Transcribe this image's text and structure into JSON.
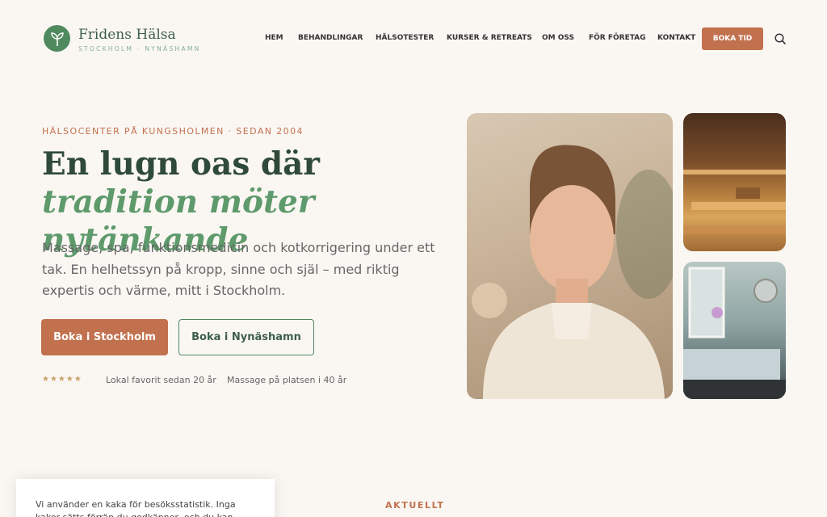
{
  "brand": {
    "name": "Fridens Hälsa",
    "subtitle": "STOCKHOLM · NYNÄSHAMN",
    "logo_icon": "sprout-icon"
  },
  "nav": {
    "items": [
      {
        "label": "HEM"
      },
      {
        "label": "BEHANDLINGAR"
      },
      {
        "label": "HÄLSOTESTER"
      },
      {
        "label": "KURSER & RETREATS"
      },
      {
        "label": "OM OSS"
      },
      {
        "label": "FÖR FÖRETAG"
      },
      {
        "label": "KONTAKT"
      }
    ],
    "book_label": "BOKA TID",
    "search_icon": "search-icon"
  },
  "hero": {
    "eyebrow": "HÄLSOCENTER PÅ KUNGSHOLMEN · SEDAN 2004",
    "title_plain": "En lugn oas där ",
    "title_highlight": "tradition möter nytänkande",
    "text": "Massage, spa, funktionsmedicin och kotkorrigering under ett tak. En helhetssyn på kropp, sinne och själ – med riktig expertis och värme, mitt i Stockholm.",
    "btn_primary": "Boka i Stockholm",
    "btn_secondary": "Boka i Nynäshamn",
    "rating_stars": "★★★★★",
    "badge_1": "Lokal favorit sedan 20 år",
    "badge_2": "Massage på platsen i 40 år"
  },
  "colors": {
    "accent": "#c2714e",
    "brand_green": "#4f8a5e",
    "background": "#faf7f3"
  },
  "cookie": {
    "text": "Vi använder en kaka för besöksstatistik. Inga kakor sätts förrän du godkänner, och du kan ändra ditt val"
  },
  "news": {
    "label": "AKTUELLT"
  }
}
